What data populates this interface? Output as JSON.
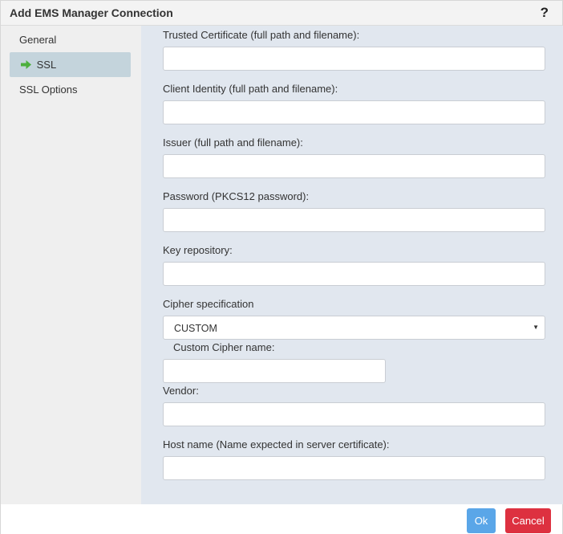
{
  "dialog": {
    "title": "Add EMS Manager Connection",
    "help_label": "?"
  },
  "sidebar": {
    "items": [
      {
        "label": "General",
        "active": false
      },
      {
        "label": "SSL",
        "active": true
      },
      {
        "label": "SSL Options",
        "active": false
      }
    ],
    "active_icon": "arrow-right-icon"
  },
  "form": {
    "trusted_certificate": {
      "label": "Trusted Certificate (full path and filename):",
      "value": ""
    },
    "client_identity": {
      "label": "Client Identity (full path and filename):",
      "value": ""
    },
    "issuer": {
      "label": "Issuer (full path and filename):",
      "value": ""
    },
    "password": {
      "label": "Password (PKCS12 password):",
      "value": ""
    },
    "key_repository": {
      "label": "Key repository:",
      "value": ""
    },
    "cipher_specification": {
      "label": "Cipher specification",
      "value": "CUSTOM"
    },
    "custom_cipher_name": {
      "label": "Custom Cipher name:",
      "value": ""
    },
    "vendor": {
      "label": "Vendor:",
      "value": ""
    },
    "host_name": {
      "label": "Host name (Name expected in server certificate):",
      "value": ""
    }
  },
  "footer": {
    "ok_label": "Ok",
    "cancel_label": "Cancel"
  },
  "colors": {
    "ok_button": "#5aa6e8",
    "cancel_button": "#dd3140",
    "active_nav": "#c4d4dc",
    "content_bg": "#e1e7ef",
    "arrow_icon": "#4caf3d"
  }
}
